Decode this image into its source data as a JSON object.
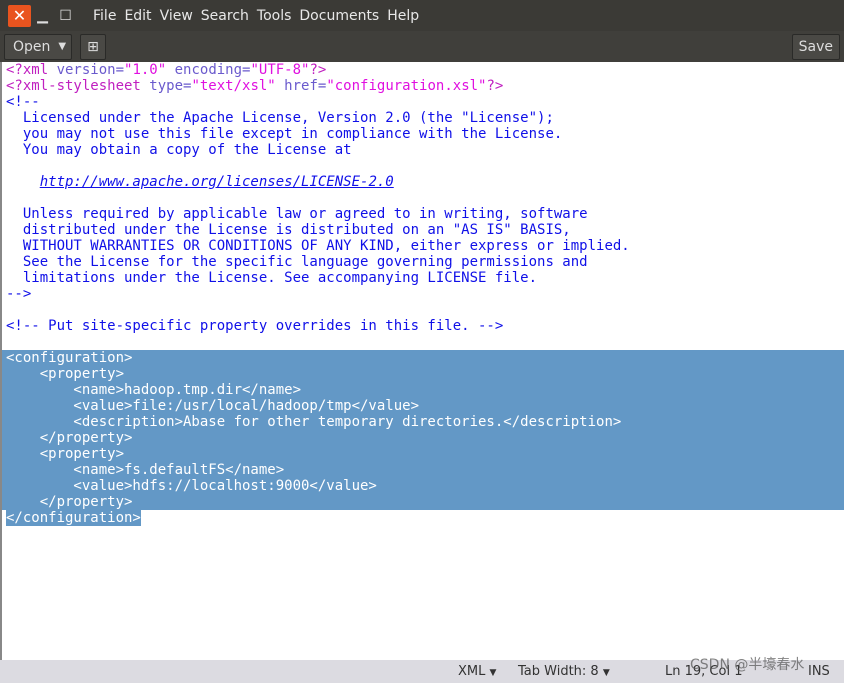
{
  "window": {
    "close_icon": "x",
    "minimize_icon": "minus",
    "maximize_icon": "square"
  },
  "menu": [
    "File",
    "Edit",
    "View",
    "Search",
    "Tools",
    "Documents",
    "Help"
  ],
  "toolbar": {
    "open_label": "Open",
    "new_tab_icon": "new-tab",
    "save_label": "Save"
  },
  "editor": {
    "lines": [
      [
        [
          "pi",
          "<?xml "
        ],
        [
          "attr",
          "version="
        ],
        [
          "val",
          "\"1.0\""
        ],
        [
          "attr",
          " encoding="
        ],
        [
          "val",
          "\"UTF-8\""
        ],
        [
          "pi",
          "?>"
        ]
      ],
      [
        [
          "pi",
          "<?xml-stylesheet "
        ],
        [
          "attr",
          "type="
        ],
        [
          "val",
          "\"text/xsl\""
        ],
        [
          "attr",
          " href="
        ],
        [
          "val",
          "\"configuration.xsl\""
        ],
        [
          "pi",
          "?>"
        ]
      ],
      [
        [
          "cm",
          "<!--"
        ]
      ],
      [
        [
          "cm",
          "  Licensed under the Apache License, Version 2.0 (the \"License\");"
        ]
      ],
      [
        [
          "cm",
          "  you may not use this file except in compliance with the License."
        ]
      ],
      [
        [
          "cm",
          "  You may obtain a copy of the License at"
        ]
      ],
      [],
      [
        [
          "cm",
          "    "
        ],
        [
          "url",
          "http://www.apache.org/licenses/LICENSE-2.0"
        ]
      ],
      [],
      [
        [
          "cm",
          "  Unless required by applicable law or agreed to in writing, software"
        ]
      ],
      [
        [
          "cm",
          "  distributed under the License is distributed on an \"AS IS\" BASIS,"
        ]
      ],
      [
        [
          "cm",
          "  WITHOUT WARRANTIES OR CONDITIONS OF ANY KIND, either express or implied."
        ]
      ],
      [
        [
          "cm",
          "  See the License for the specific language governing permissions and"
        ]
      ],
      [
        [
          "cm",
          "  limitations under the License. See accompanying LICENSE file."
        ]
      ],
      [
        [
          "cm",
          "-->"
        ]
      ],
      [],
      [
        [
          "cm",
          "<!-- Put site-specific property overrides in this file. -->"
        ]
      ],
      [],
      [
        [
          "sel",
          "<configuration>"
        ]
      ],
      [
        [
          "sel",
          "    <property>"
        ]
      ],
      [
        [
          "sel",
          "        <name>hadoop.tmp.dir</name>"
        ]
      ],
      [
        [
          "sel",
          "        <value>file:/usr/local/hadoop/tmp</value>"
        ]
      ],
      [
        [
          "sel",
          "        <description>Abase for other temporary directories.</description>"
        ]
      ],
      [
        [
          "sel",
          "    </property>"
        ]
      ],
      [
        [
          "sel",
          "    <property>"
        ]
      ],
      [
        [
          "sel",
          "        <name>fs.defaultFS</name>"
        ]
      ],
      [
        [
          "sel",
          "        <value>hdfs://localhost:9000</value>"
        ]
      ],
      [
        [
          "sel",
          "    </property>"
        ]
      ],
      [
        [
          "sellast",
          "</configuration>"
        ]
      ]
    ],
    "selection_color": "#6398c6"
  },
  "status": {
    "language": "XML",
    "tab_width": "Tab Width: 8",
    "position": "Ln 19, Col 1",
    "mode": "INS",
    "watermark": "CSDN @半壕春水"
  }
}
